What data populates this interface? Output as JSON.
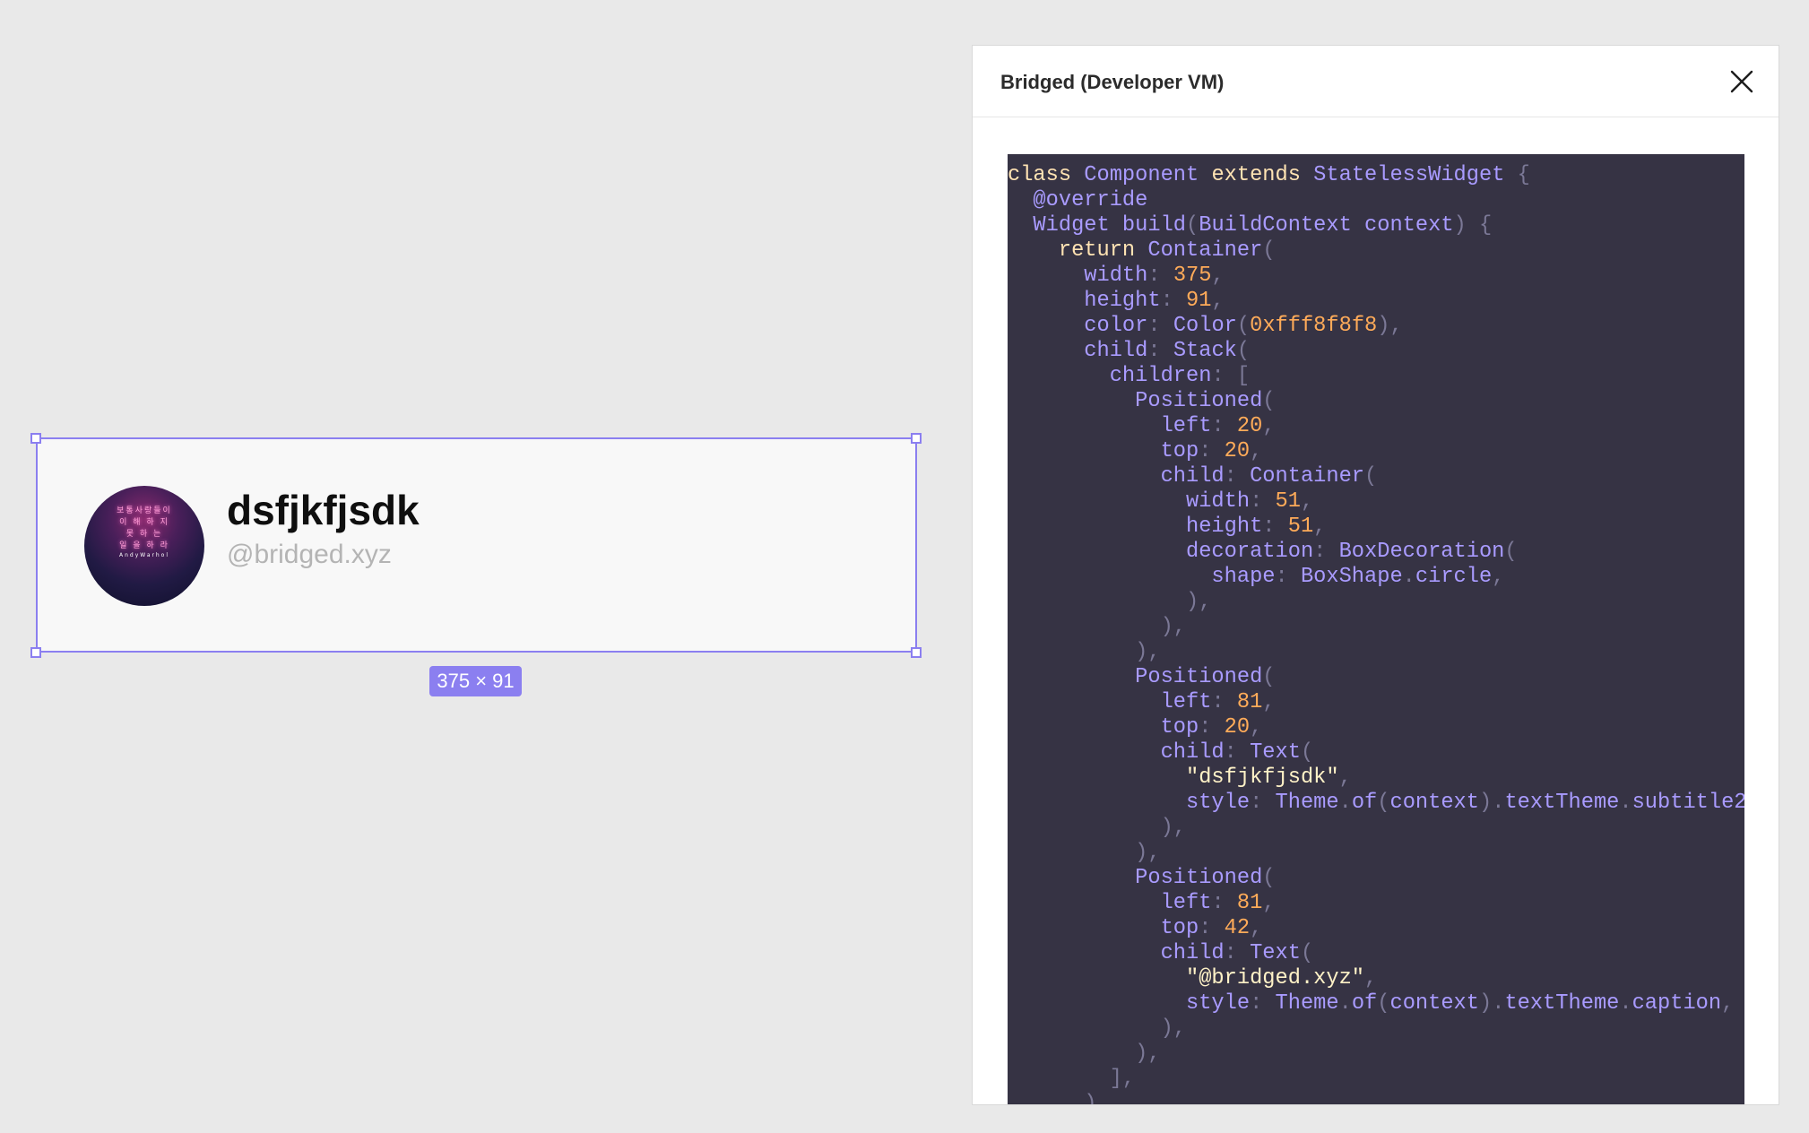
{
  "canvas": {
    "profile_name": "dsfjkfjsdk",
    "profile_handle": "@bridged.xyz",
    "size_label": "375 × 91",
    "avatar_text_lines": [
      "보통사랑들이",
      "이 해 하 지",
      "못  하  는",
      "일 을 하 라"
    ],
    "avatar_signature": "AndyWarhol"
  },
  "panel": {
    "title": "Bridged (Developer VM)",
    "close_icon": "close-icon"
  },
  "code_lines": [
    [
      [
        "kw",
        "class"
      ],
      [
        "t",
        " Component "
      ],
      [
        "kw",
        "extends"
      ],
      [
        "t",
        " StatelessWidget "
      ],
      [
        "p",
        "{"
      ]
    ],
    [
      [
        "t",
        "  @override"
      ]
    ],
    [
      [
        "t",
        "  Widget build"
      ],
      [
        "p",
        "("
      ],
      [
        "t",
        "BuildContext context"
      ],
      [
        "p",
        ") {"
      ]
    ],
    [
      [
        "t",
        "    "
      ],
      [
        "kw",
        "return"
      ],
      [
        "t",
        " Container"
      ],
      [
        "p",
        "("
      ]
    ],
    [
      [
        "t",
        "      width"
      ],
      [
        "p",
        ": "
      ],
      [
        "num",
        "375"
      ],
      [
        "p",
        ","
      ]
    ],
    [
      [
        "t",
        "      height"
      ],
      [
        "p",
        ": "
      ],
      [
        "num",
        "91"
      ],
      [
        "p",
        ","
      ]
    ],
    [
      [
        "t",
        "      color"
      ],
      [
        "p",
        ": "
      ],
      [
        "t",
        "Color"
      ],
      [
        "p",
        "("
      ],
      [
        "num",
        "0xfff8f8f8"
      ],
      [
        "p",
        "),"
      ]
    ],
    [
      [
        "t",
        "      child"
      ],
      [
        "p",
        ": "
      ],
      [
        "t",
        "Stack"
      ],
      [
        "p",
        "("
      ]
    ],
    [
      [
        "t",
        "        children"
      ],
      [
        "p",
        ": ["
      ]
    ],
    [
      [
        "t",
        "          Positioned"
      ],
      [
        "p",
        "("
      ]
    ],
    [
      [
        "t",
        "            left"
      ],
      [
        "p",
        ": "
      ],
      [
        "num",
        "20"
      ],
      [
        "p",
        ","
      ]
    ],
    [
      [
        "t",
        "            top"
      ],
      [
        "p",
        ": "
      ],
      [
        "num",
        "20"
      ],
      [
        "p",
        ","
      ]
    ],
    [
      [
        "t",
        "            child"
      ],
      [
        "p",
        ": "
      ],
      [
        "t",
        "Container"
      ],
      [
        "p",
        "("
      ]
    ],
    [
      [
        "t",
        "              width"
      ],
      [
        "p",
        ": "
      ],
      [
        "num",
        "51"
      ],
      [
        "p",
        ","
      ]
    ],
    [
      [
        "t",
        "              height"
      ],
      [
        "p",
        ": "
      ],
      [
        "num",
        "51"
      ],
      [
        "p",
        ","
      ]
    ],
    [
      [
        "t",
        "              decoration"
      ],
      [
        "p",
        ": "
      ],
      [
        "t",
        "BoxDecoration"
      ],
      [
        "p",
        "("
      ]
    ],
    [
      [
        "t",
        "                shape"
      ],
      [
        "p",
        ": "
      ],
      [
        "t",
        "BoxShape"
      ],
      [
        "p",
        "."
      ],
      [
        "t",
        "circle"
      ],
      [
        "p",
        ","
      ]
    ],
    [
      [
        "p",
        "              ),"
      ]
    ],
    [
      [
        "p",
        "            ),"
      ]
    ],
    [
      [
        "p",
        "          ),"
      ]
    ],
    [
      [
        "t",
        "          Positioned"
      ],
      [
        "p",
        "("
      ]
    ],
    [
      [
        "t",
        "            left"
      ],
      [
        "p",
        ": "
      ],
      [
        "num",
        "81"
      ],
      [
        "p",
        ","
      ]
    ],
    [
      [
        "t",
        "            top"
      ],
      [
        "p",
        ": "
      ],
      [
        "num",
        "20"
      ],
      [
        "p",
        ","
      ]
    ],
    [
      [
        "t",
        "            child"
      ],
      [
        "p",
        ": "
      ],
      [
        "t",
        "Text"
      ],
      [
        "p",
        "("
      ]
    ],
    [
      [
        "str",
        "              \"dsfjkfjsdk\""
      ],
      [
        "p",
        ","
      ]
    ],
    [
      [
        "t",
        "              style"
      ],
      [
        "p",
        ": "
      ],
      [
        "t",
        "Theme"
      ],
      [
        "p",
        "."
      ],
      [
        "t",
        "of"
      ],
      [
        "p",
        "("
      ],
      [
        "t",
        "context"
      ],
      [
        "p",
        ")."
      ],
      [
        "t",
        "textTheme"
      ],
      [
        "p",
        "."
      ],
      [
        "t",
        "subtitle2"
      ],
      [
        "p",
        ","
      ]
    ],
    [
      [
        "p",
        "            ),"
      ]
    ],
    [
      [
        "p",
        "          ),"
      ]
    ],
    [
      [
        "t",
        "          Positioned"
      ],
      [
        "p",
        "("
      ]
    ],
    [
      [
        "t",
        "            left"
      ],
      [
        "p",
        ": "
      ],
      [
        "num",
        "81"
      ],
      [
        "p",
        ","
      ]
    ],
    [
      [
        "t",
        "            top"
      ],
      [
        "p",
        ": "
      ],
      [
        "num",
        "42"
      ],
      [
        "p",
        ","
      ]
    ],
    [
      [
        "t",
        "            child"
      ],
      [
        "p",
        ": "
      ],
      [
        "t",
        "Text"
      ],
      [
        "p",
        "("
      ]
    ],
    [
      [
        "str",
        "              \"@bridged.xyz\""
      ],
      [
        "p",
        ","
      ]
    ],
    [
      [
        "t",
        "              style"
      ],
      [
        "p",
        ": "
      ],
      [
        "t",
        "Theme"
      ],
      [
        "p",
        "."
      ],
      [
        "t",
        "of"
      ],
      [
        "p",
        "("
      ],
      [
        "t",
        "context"
      ],
      [
        "p",
        ")."
      ],
      [
        "t",
        "textTheme"
      ],
      [
        "p",
        "."
      ],
      [
        "t",
        "caption"
      ],
      [
        "p",
        ","
      ]
    ],
    [
      [
        "p",
        "            ),"
      ]
    ],
    [
      [
        "p",
        "          ),"
      ]
    ],
    [
      [
        "p",
        "        ],"
      ]
    ],
    [
      [
        "p",
        "      ),"
      ]
    ]
  ]
}
